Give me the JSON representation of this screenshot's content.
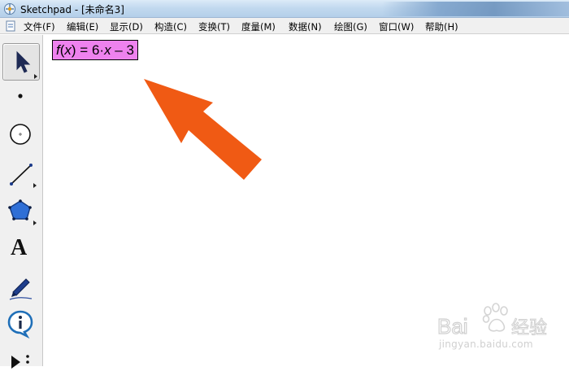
{
  "window": {
    "title": "Sketchpad  - [未命名3]"
  },
  "menu": {
    "items": [
      {
        "label": "文件(F)"
      },
      {
        "label": "编辑(E)"
      },
      {
        "label": "显示(D)"
      },
      {
        "label": "构造(C)"
      },
      {
        "label": "变换(T)"
      },
      {
        "label": "度量(M)"
      },
      {
        "label": "数据(N)"
      },
      {
        "label": "绘图(G)"
      },
      {
        "label": "窗口(W)"
      },
      {
        "label": "帮助(H)"
      }
    ]
  },
  "toolbox": {
    "tools": [
      {
        "name": "arrow-select-tool",
        "selected": true
      },
      {
        "name": "point-tool"
      },
      {
        "name": "compass-tool"
      },
      {
        "name": "straightedge-tool"
      },
      {
        "name": "polygon-tool"
      },
      {
        "name": "text-tool",
        "glyph": "A"
      },
      {
        "name": "marker-tool"
      },
      {
        "name": "information-tool"
      },
      {
        "name": "custom-tool"
      }
    ]
  },
  "canvas": {
    "function": {
      "f": "f",
      "x_in": "x",
      "mid": ") = 6·",
      "x_out": "x",
      "tail": " – 3",
      "background": "#ee82ee"
    },
    "annotation_arrow_color": "#f05a14"
  },
  "watermark": {
    "brand": "Baidu经验",
    "url": "jingyan.baidu.com"
  }
}
